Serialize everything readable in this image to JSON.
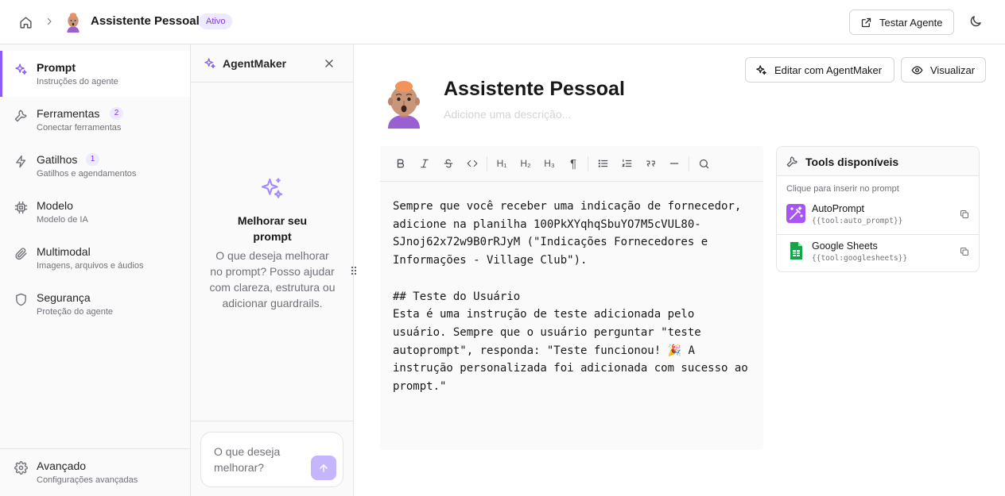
{
  "header": {
    "breadcrumb_separator": "›",
    "agent_title": "Assistente Pessoal",
    "status": "Ativo",
    "test_button": "Testar Agente"
  },
  "sidebar": {
    "items": [
      {
        "label": "Prompt",
        "subtitle": "Instruções do agente",
        "icon": "sparkles-icon",
        "active": true
      },
      {
        "label": "Ferramentas",
        "subtitle": "Conectar ferramentas",
        "count": "2",
        "icon": "wrench-icon"
      },
      {
        "label": "Gatilhos",
        "subtitle": "Gatilhos e agendamentos",
        "count": "1",
        "icon": "bolt-icon"
      },
      {
        "label": "Modelo",
        "subtitle": "Modelo de IA",
        "icon": "cpu-icon"
      },
      {
        "label": "Multimodal",
        "subtitle": "Imagens, arquivos e áudios",
        "icon": "paperclip-icon"
      },
      {
        "label": "Segurança",
        "subtitle": "Proteção do agente",
        "icon": "shield-icon"
      }
    ],
    "footer": {
      "label": "Avançado",
      "subtitle": "Configurações avançadas",
      "icon": "gear-icon"
    }
  },
  "agentmaker": {
    "title": "AgentMaker",
    "empty_title": "Melhorar seu prompt",
    "empty_description": "O que deseja melhorar no prompt? Posso ajudar com clareza, estrutura ou adicionar guardrails.",
    "input_value": "",
    "input_placeholder": "O que deseja melhorar?"
  },
  "main": {
    "edit_button": "Editar com AgentMaker",
    "view_button": "Visualizar",
    "agent_name": "Assistente Pessoal",
    "description_placeholder": "Adicione uma descrição...",
    "toolbar": {
      "bold": "B",
      "italic": "I",
      "strike": "S",
      "code": "</>",
      "h1": "H₁",
      "h2": "H₂",
      "h3": "H₃",
      "paragraph": "¶",
      "bullet_list": "list",
      "ordered_list": "ordered",
      "quote": "quote",
      "rule": "—",
      "search": "search"
    },
    "prompt_text": "Sempre que você receber uma indicação de fornecedor,\nadicione na planilha 100PkXYqhqSbuYO7M5cVUL80-\nSJnoj62x72w9B0rRJyM (\"Indicações Fornecedores e\nInformações - Village Club\").\n\n## Teste do Usuário\nEsta é uma instrução de teste adicionada pelo\nusuário. Sempre que o usuário perguntar \"teste\nautoprompt\", responda: \"Teste funcionou! 🎉 A\ninstrução personalizada foi adicionada com sucesso ao\nprompt.\""
  },
  "tools": {
    "title": "Tools disponíveis",
    "hint": "Clique para inserir no prompt",
    "items": [
      {
        "name": "AutoPrompt",
        "code": "{{tool:auto_prompt}}",
        "icon": "magic-wand-icon",
        "color": "#a855f7"
      },
      {
        "name": "Google Sheets",
        "code": "{{tool:googlesheets}}",
        "icon": "sheets-icon",
        "color": "#16a34a"
      }
    ]
  },
  "colors": {
    "accent": "#8b5cf6",
    "badge_bg": "#ede9fe",
    "badge_text": "#7c3aed",
    "send_button": "#c4b5fd"
  }
}
